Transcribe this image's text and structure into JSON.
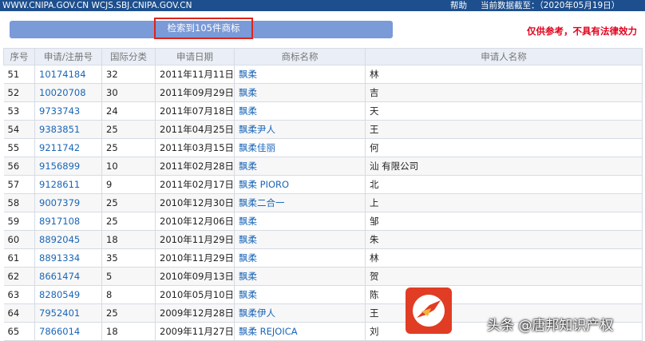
{
  "topbar": {
    "urls": "WWW.CNIPA.GOV.CN WCJS.SBJ.CNIPA.GOV.CN",
    "help": "帮助",
    "as_of": "当前数据截至：（2020年05月19日）"
  },
  "result_count_label": "检索到105件商标",
  "disclaimer": "仅供参考，不具有法律效力",
  "table": {
    "headers": [
      "序号",
      "申请/注册号",
      "国际分类",
      "申请日期",
      "商标名称",
      "申请人名称"
    ],
    "rows": [
      {
        "no": "51",
        "reg": "10174184",
        "cls": "32",
        "date": "2011年11月11日",
        "mark": "飘柔",
        "applicant": "林"
      },
      {
        "no": "52",
        "reg": "10020708",
        "cls": "30",
        "date": "2011年09月29日",
        "mark": "飘柔",
        "applicant": "吉"
      },
      {
        "no": "53",
        "reg": "9733743",
        "cls": "24",
        "date": "2011年07月18日",
        "mark": "飘柔",
        "applicant": "天"
      },
      {
        "no": "54",
        "reg": "9383851",
        "cls": "25",
        "date": "2011年04月25日",
        "mark": "飘柔尹人",
        "applicant": "王"
      },
      {
        "no": "55",
        "reg": "9211742",
        "cls": "25",
        "date": "2011年03月15日",
        "mark": "飘柔佳丽",
        "applicant": "何"
      },
      {
        "no": "56",
        "reg": "9156899",
        "cls": "10",
        "date": "2011年02月28日",
        "mark": "飘柔",
        "applicant": "汕                                        有限公司"
      },
      {
        "no": "57",
        "reg": "9128611",
        "cls": "9",
        "date": "2011年02月17日",
        "mark": "飘柔 PIORO",
        "applicant": "北"
      },
      {
        "no": "58",
        "reg": "9007379",
        "cls": "25",
        "date": "2010年12月30日",
        "mark": "飘柔二合一",
        "applicant": "上"
      },
      {
        "no": "59",
        "reg": "8917108",
        "cls": "25",
        "date": "2010年12月06日",
        "mark": "飘柔",
        "applicant": "邹"
      },
      {
        "no": "60",
        "reg": "8892045",
        "cls": "18",
        "date": "2010年11月29日",
        "mark": "飘柔",
        "applicant": "朱"
      },
      {
        "no": "61",
        "reg": "8891334",
        "cls": "35",
        "date": "2010年11月29日",
        "mark": "飘柔",
        "applicant": "林"
      },
      {
        "no": "62",
        "reg": "8661474",
        "cls": "5",
        "date": "2010年09月13日",
        "mark": "飘柔",
        "applicant": "贺"
      },
      {
        "no": "63",
        "reg": "8280549",
        "cls": "8",
        "date": "2010年05月10日",
        "mark": "飘柔",
        "applicant": "陈"
      },
      {
        "no": "64",
        "reg": "7952401",
        "cls": "25",
        "date": "2009年12月28日",
        "mark": "飘柔伊人",
        "applicant": "王"
      },
      {
        "no": "65",
        "reg": "7866014",
        "cls": "18",
        "date": "2009年11月27日",
        "mark": "飘柔 REJOICA",
        "applicant": "刘"
      }
    ]
  },
  "watermark": {
    "text": "头条 @唐邦知识产权"
  }
}
